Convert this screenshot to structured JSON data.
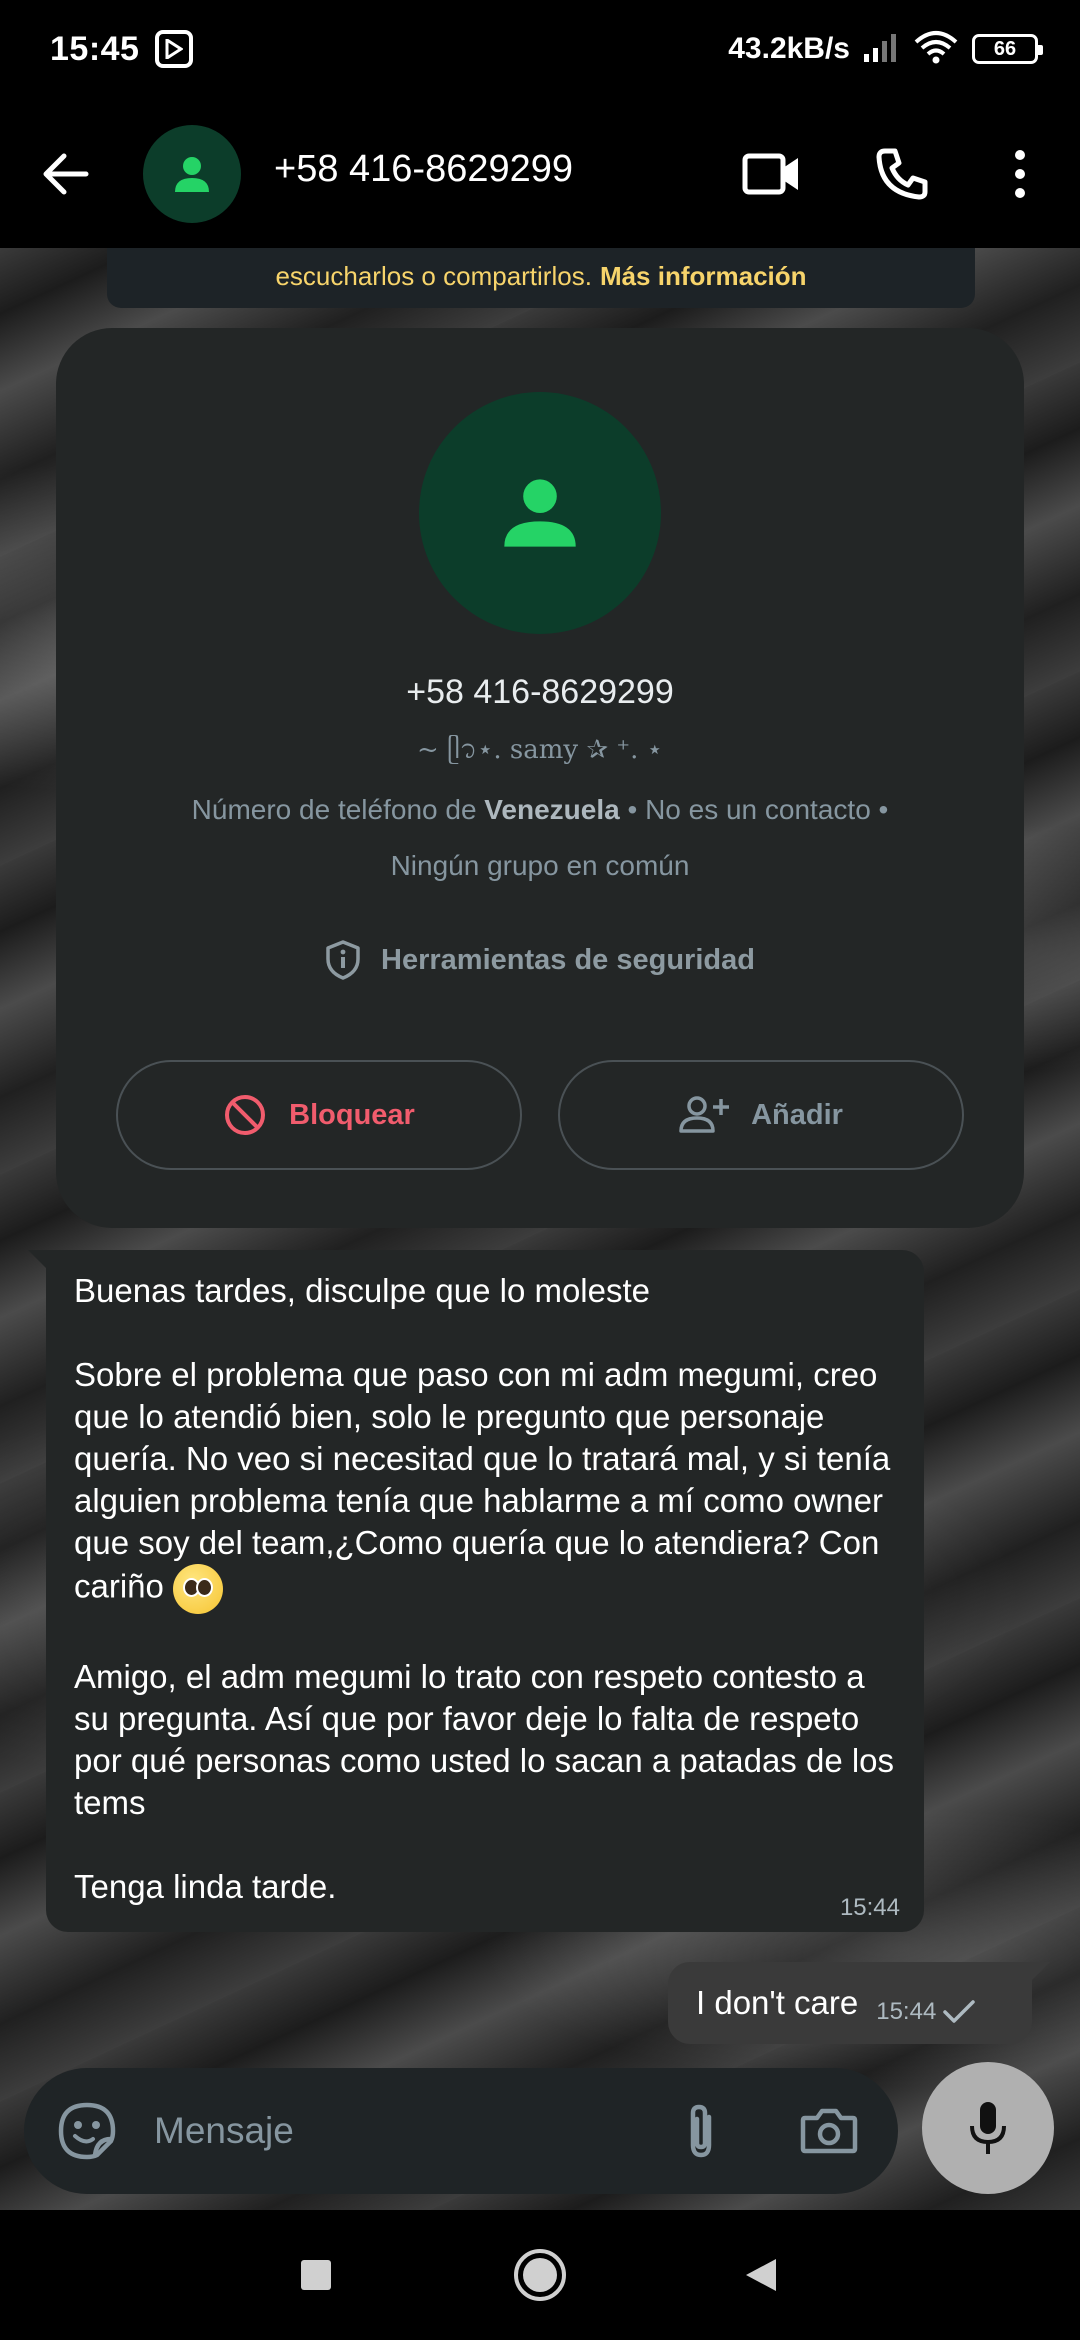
{
  "status_bar": {
    "time": "15:45",
    "network_speed": "43.2kB/s",
    "battery": "66"
  },
  "header": {
    "title": "+58 416-8629299"
  },
  "encryption_notice": {
    "text": "escucharlos o compartirlos.",
    "more_link": "Más información"
  },
  "contact_card": {
    "phone": "+58 416-8629299",
    "username": "~ ᥫ᭡⋆. samy ✰ ⁺. ⋆",
    "info_prefix": "Número de teléfono de ",
    "country": "Venezuela",
    "info_suffix": " • No es un contacto •",
    "info_line2": "Ningún grupo en común",
    "security_tools": "Herramientas de seguridad",
    "block_label": "Bloquear",
    "add_label": "Añadir"
  },
  "messages": {
    "incoming": {
      "p1": "Buenas tardes, disculpe que lo moleste",
      "p2": "Sobre el problema que paso con mi adm megumi, creo que lo atendió bien, solo le pregunto que personaje quería. No veo si necesitad que lo tratará mal, y si tenía alguien problema tenía que hablarme a mí como owner que soy del team,¿Como quería que lo atendiera? Con cariño",
      "p3": "Amigo, el adm megumi lo trato con respeto contesto a su pregunta. Así que por favor deje lo falta de respeto por qué personas como usted lo sacan a patadas de los tems",
      "p4": "Tenga linda tarde.",
      "time": "15:44"
    },
    "outgoing": {
      "text": "I don't care",
      "time": "15:44"
    }
  },
  "composer": {
    "placeholder": "Mensaje"
  },
  "colors": {
    "accent_green": "#25d366",
    "avatar_bg": "#0c3d2a",
    "block_red": "#f15c6d",
    "notice_yellow": "#f7d46b"
  }
}
